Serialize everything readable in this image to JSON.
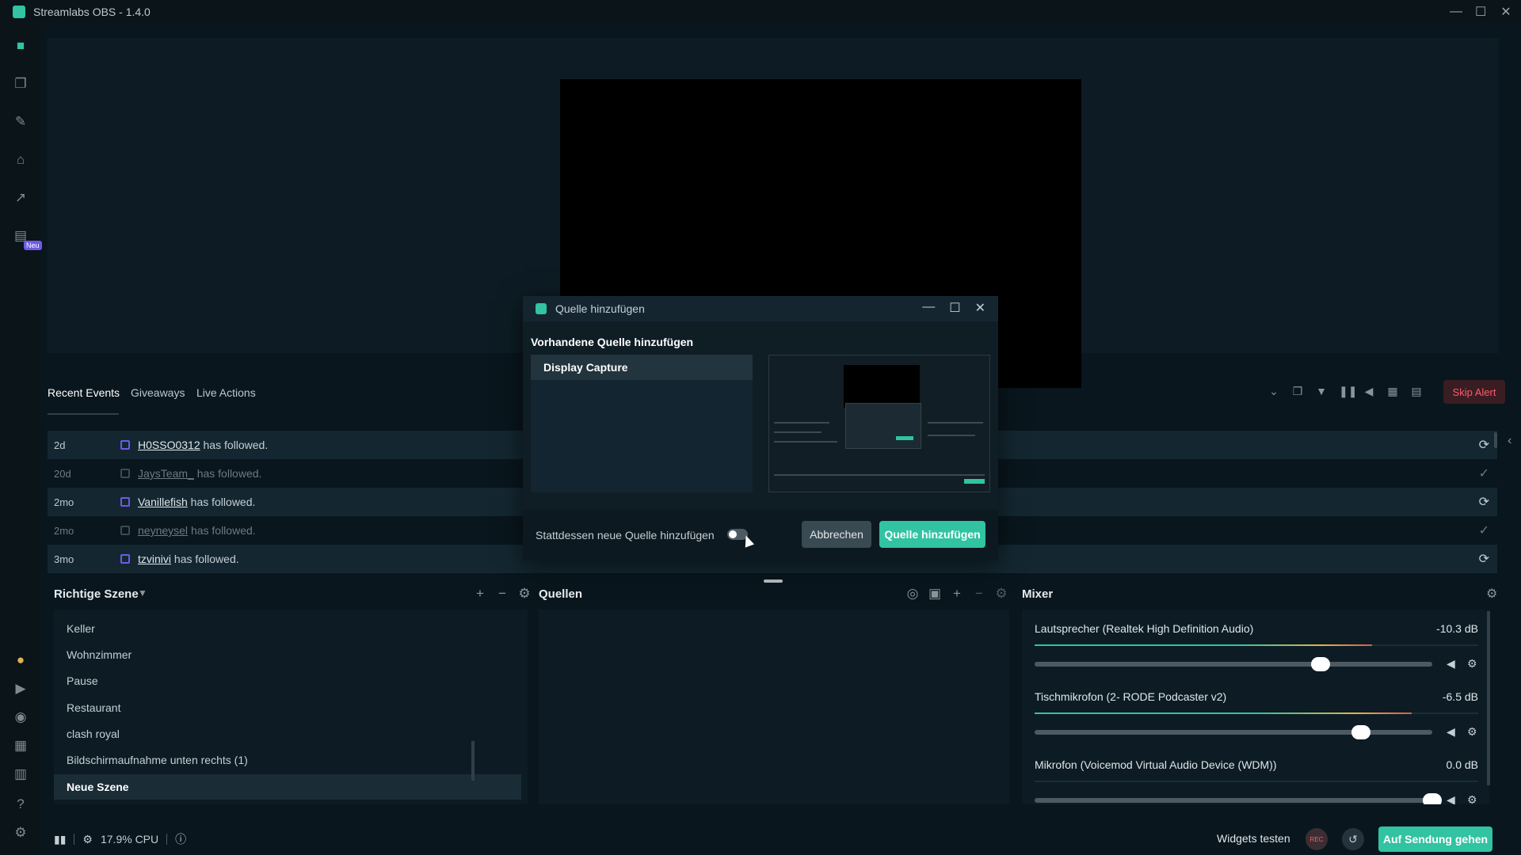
{
  "app": {
    "title": "Streamlabs OBS - 1.4.0"
  },
  "leftnav": {
    "new_badge": "Neu"
  },
  "events": {
    "tabs": [
      "Recent Events",
      "Giveaways",
      "Live Actions"
    ],
    "skip_alert": "Skip Alert",
    "rows": [
      {
        "time": "2d",
        "name": "H0SSO0312",
        "action": "has followed."
      },
      {
        "time": "20d",
        "name": "JaysTeam_",
        "action": "has followed."
      },
      {
        "time": "2mo",
        "name": "Vanillefish",
        "action": "has followed."
      },
      {
        "time": "2mo",
        "name": "neyneysel",
        "action": "has followed."
      },
      {
        "time": "3mo",
        "name": "tzvinivi",
        "action": "has followed."
      }
    ]
  },
  "scenes": {
    "title": "Richtige Szene",
    "items": [
      "Keller",
      "Wohnzimmer",
      "Pause",
      "Restaurant",
      "clash royal",
      "Bildschirmaufnahme unten rechts (1)",
      "Neue Szene"
    ]
  },
  "sources": {
    "title": "Quellen"
  },
  "mixer": {
    "title": "Mixer",
    "channels": [
      {
        "name": "Lautsprecher (Realtek High Definition Audio)",
        "db": "-10.3 dB",
        "level": 0.76,
        "volume": 0.72
      },
      {
        "name": "Tischmikrofon (2- RODE Podcaster v2)",
        "db": "-6.5 dB",
        "level": 0.85,
        "volume": 0.82
      },
      {
        "name": "Mikrofon (Voicemod Virtual Audio Device (WDM))",
        "db": "0.0 dB",
        "level": 0,
        "volume": 1.0
      }
    ]
  },
  "footer": {
    "cpu": "17.9% CPU",
    "widgets_test": "Widgets testen",
    "rec": "REC",
    "go_live": "Auf Sendung gehen"
  },
  "modal": {
    "title": "Quelle hinzufügen",
    "heading": "Vorhandene Quelle hinzufügen",
    "selected_source": "Display Capture",
    "toggle_label": "Stattdessen neue Quelle hinzufügen",
    "cancel": "Abbrechen",
    "add": "Quelle hinzufügen"
  },
  "colors": {
    "accent": "#31c3a2",
    "alert": "#ff5a6e",
    "bg": "#09161d"
  }
}
